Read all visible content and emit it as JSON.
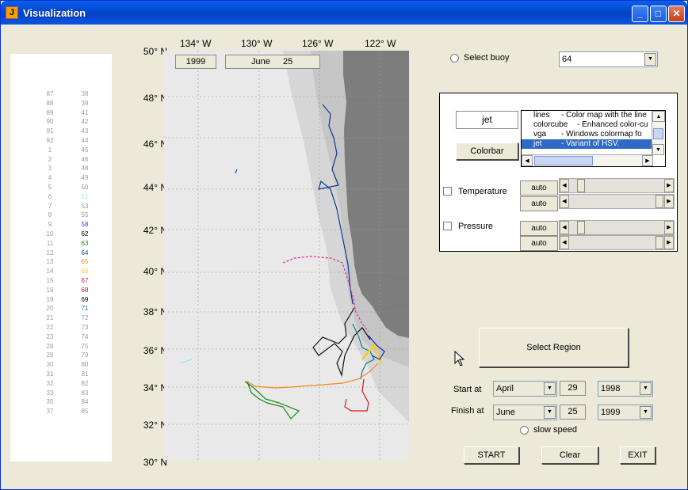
{
  "window": {
    "title": "Visualization",
    "buttons": [
      "minimize",
      "maximize",
      "close"
    ]
  },
  "map": {
    "year": "1999",
    "month": "June",
    "day": "25",
    "lat_labels": [
      "50° N",
      "48° N",
      "46° N",
      "44° N",
      "42° N",
      "40° N",
      "38° N",
      "36° N",
      "34° N",
      "32° N",
      "30° N"
    ],
    "lon_labels": [
      "134° W",
      "130° W",
      "126° W",
      "122° W"
    ]
  },
  "buoy_list": {
    "col1": [
      "87",
      "88",
      "89",
      "90",
      "91",
      "92",
      "1",
      "2",
      "3",
      "4",
      "5",
      "6",
      "7",
      "8",
      "9",
      "10",
      "11",
      "12",
      "13",
      "14",
      "15",
      "16",
      "19",
      "20",
      "21",
      "22",
      "23",
      "28",
      "29",
      "30",
      "31",
      "32",
      "33",
      "35",
      "37"
    ],
    "col2": [
      "38",
      "39",
      "41",
      "42",
      "43",
      "44",
      "45",
      "46",
      "48",
      "49",
      "50",
      "51",
      "53",
      "55",
      "58",
      "62",
      "63",
      "64",
      "65",
      "66",
      "67",
      "68",
      "69",
      "71",
      "72",
      "73",
      "74",
      "75",
      "79",
      "80",
      "81",
      "82",
      "83",
      "84",
      "85"
    ],
    "col2_colors": {
      "51": "#a6e3f7",
      "58": "#1a56c8",
      "62": "#000000",
      "63": "#1a8a1a",
      "64": "#0a4a8a",
      "65": "#f08a1a",
      "66": "#f2d21a",
      "67": "#d41a4a",
      "68": "#b01a1a",
      "69": "#000000",
      "71": "#0a7a8a"
    }
  },
  "select_buoy": {
    "label": "Select buoy",
    "value": "64"
  },
  "colormap": {
    "name": "jet",
    "colorbar_label": "Colorbar",
    "list": [
      {
        "name": "lines",
        "desc": "- Color map with the line"
      },
      {
        "name": "colorcube",
        "desc": "- Enhanced color-cu"
      },
      {
        "name": "vga",
        "desc": "- Windows colormap fo"
      },
      {
        "name": "jet",
        "desc": "- Variant of HSV."
      }
    ]
  },
  "temperature": {
    "label": "Temperature",
    "min": "auto",
    "max": "auto"
  },
  "pressure": {
    "label": "Pressure",
    "min": "auto",
    "max": "auto"
  },
  "select_region_label": "Select Region",
  "start": {
    "label": "Start at",
    "month": "April",
    "day": "29",
    "year": "1998"
  },
  "finish": {
    "label": "Finish at",
    "month": "June",
    "day": "25",
    "year": "1999"
  },
  "slow_speed_label": "slow speed",
  "buttons": {
    "start": "START",
    "clear": "Clear",
    "exit": "EXIT"
  }
}
